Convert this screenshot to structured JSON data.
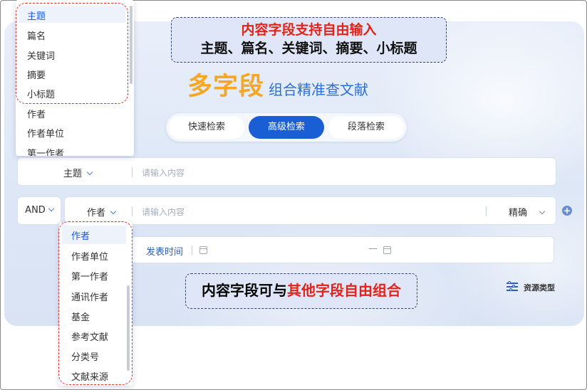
{
  "callouts": {
    "top_line1": "内容字段支持自由输入",
    "top_line2": "主题、篇名、关键词、摘要、小标题",
    "bottom_normal": "内容字段可与",
    "bottom_red": "其他字段自由组合"
  },
  "hero": {
    "big": "多字段",
    "small": "组合精准查文献"
  },
  "tabs": [
    "快速检索",
    "高级检索",
    "段落检索"
  ],
  "active_tab": "高级检索",
  "row1": {
    "field": "主题",
    "placeholder": "请输入内容"
  },
  "row2": {
    "logic": "AND",
    "field": "作者",
    "placeholder": "请输入内容",
    "match": "精确"
  },
  "row3": {
    "field": "发表时间",
    "range_sep": "—"
  },
  "resource_type": "资源类型",
  "dropdown_content": {
    "selected": "主题",
    "items": [
      "主题",
      "篇名",
      "关键词",
      "摘要",
      "小标题",
      "作者",
      "作者单位",
      "第一作者"
    ]
  },
  "dropdown_other": {
    "selected": "作者",
    "items": [
      "作者",
      "作者单位",
      "第一作者",
      "通讯作者",
      "基金",
      "参考文献",
      "分类号",
      "文献来源"
    ]
  },
  "colors": {
    "accent": "#1a5ed6",
    "highlight_red": "#e3231a",
    "hero_orange": "#f5a623"
  }
}
